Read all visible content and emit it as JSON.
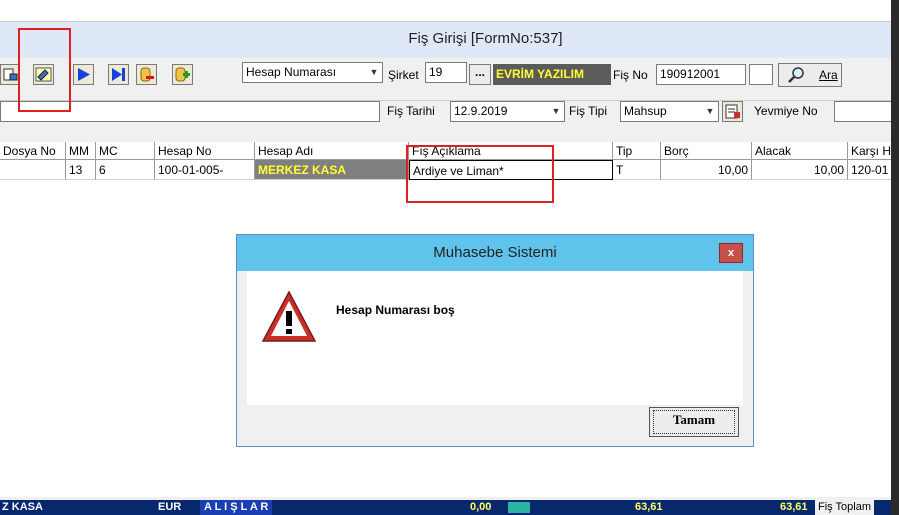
{
  "window": {
    "title": "Fiş Girişi [FormNo:537]"
  },
  "toolbar": {
    "account_mode": "Hesap Numarası",
    "company_label": "Şirket",
    "company_value": "19",
    "company_lookup": "...",
    "company_name": "EVRİM YAZILIM",
    "slip_no_label": "Fiş No",
    "slip_no_value": "190912001",
    "search_label": "Ara"
  },
  "row2": {
    "slip_date_label": "Fiş Tarihi",
    "slip_date_value": "12.9.2019",
    "slip_type_label": "Fiş Tipi",
    "slip_type_value": "Mahsup",
    "journal_no_label": "Yevmiye No"
  },
  "grid": {
    "columns": [
      "Dosya No",
      "MM",
      "MC",
      "Hesap No",
      "Hesap Adı",
      "Fış Açıklama",
      "Tip",
      "Borç",
      "Alacak",
      "Karşı H"
    ],
    "rows": [
      [
        "",
        "13",
        "6",
        "100-01-005-",
        "MERKEZ KASA",
        "Ardiye ve Liman*",
        "T",
        "10,00",
        "10,00",
        "120-01"
      ]
    ]
  },
  "statusbar": {
    "cell1": "Z KASA",
    "cell2": "EUR",
    "cell3": "A L I Ş L A R",
    "cell4": "0,00",
    "cell5": "63,61",
    "cell6": "63,61",
    "cell7": "Fiş Toplam"
  },
  "dialog": {
    "title": "Muhasebe Sistemi",
    "close": "x",
    "message": "Hesap Numarası boş",
    "ok_label": "Tamam"
  },
  "colors": {
    "highlight_red": "#e02020",
    "dialog_title": "#5fc3ec",
    "kasa_text": "#ffff33",
    "status_bg": "#07286d"
  }
}
